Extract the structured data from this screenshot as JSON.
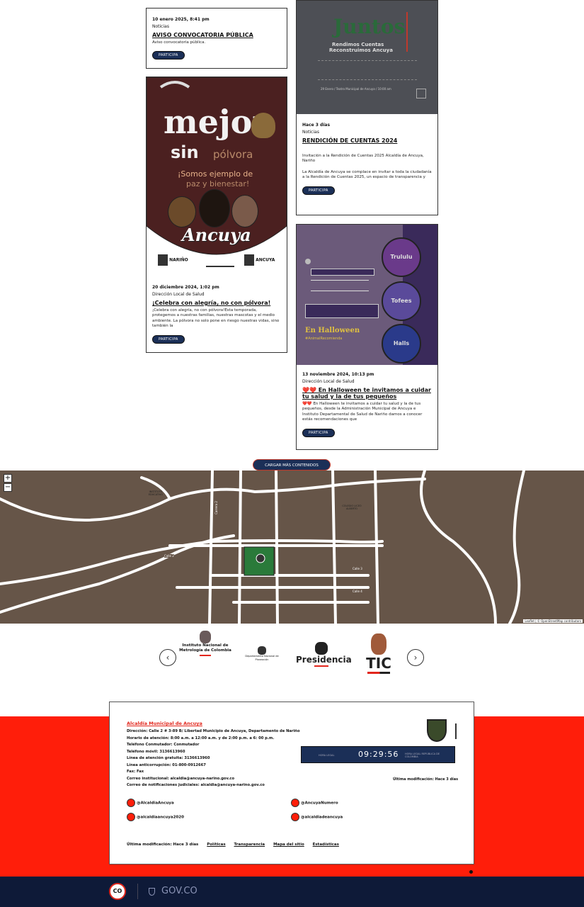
{
  "news": [
    {
      "date": "10 enero 2025, 8:41 pm",
      "category": "Noticias",
      "title": "AVISO CONVOCATORIA PÚBLICA",
      "desc": "Aviso convocatoria pública.",
      "button": "PARTICIPA"
    },
    {
      "image": {
        "line1": "Juntos",
        "line2": "Rendimos Cuentas",
        "line3": "Reconstruimos Ancuya",
        "footer": "29 Enero / Teatro Municipal de Ancuya / 10:00 am"
      },
      "date": "Hace 3 días",
      "category": "Noticias",
      "title": "RENDICIÓN DE CUENTAS 2024",
      "desc1": "Invitación a la Rendición de Cuentas 2025 Alcaldía de Ancuya, Nariño",
      "desc2": "La Alcaldía de Ancuya se complace en invitar a toda la ciudadanía a la Rendición de Cuentas 2025, un espacio de transparencia y",
      "button": "PARTICIPA"
    },
    {
      "image": {
        "word1": "mejor",
        "word2": "sin",
        "word3": "pólvora",
        "slogan1": "¡Somos ejemplo de",
        "slogan2": "paz y bienestar!",
        "brand": "Ancuya",
        "logo1": "NARIÑO",
        "logo2": "ANCUYA"
      },
      "date": "20 diciembre 2024, 1:02 pm",
      "category": "Dirección Local de Salud",
      "title": "¡Celebra con alegría, no con pólvora!",
      "desc": "¡Celebra con alegría, no con pólvora!Esta temporada, protegemos a nuestras familias, nuestras mascotas y el medio ambiente. La pólvora no solo pone en riesgo nuestras vidas, sino también la",
      "button": "PARTICIPA"
    },
    {
      "image": {
        "heading": "En Halloween",
        "hashtag": "#AnimalRecomienda",
        "candy1": "Trululu",
        "candy2": "Tofees",
        "candy3": "Halls"
      },
      "date": "13 noviembre 2024, 10:13 pm",
      "category": "Dirección Local de Salud",
      "title": "❤️❤️ En Halloween te invitamos a cuidar tu salud y la de tus pequeños",
      "desc": "❤️❤️ En Halloween te invitamos a cuidar tu salud y la de tus pequeños, desde la Administración Municipal de Ancuya e Instituto Departamental de Salud de Nariño damos a conocer estás recomendaciones que",
      "button": "PARTICIPA"
    }
  ],
  "load_more": "CARGAR MÁS CONTENIDOS",
  "map": {
    "zoom_in": "+",
    "zoom_out": "−",
    "attribution": "Leaflet | © OpenStreetMap contributors",
    "streets": [
      "Calle 2",
      "Carrera 2",
      "Calle 3",
      "Calle 4"
    ],
    "places": [
      "INSTITUTO EDUCATIVO",
      "COLEGIO LICEO ALBERTO"
    ]
  },
  "partners": [
    {
      "name": "Instituto Nacional de Metrología de Colombia"
    },
    {
      "name": "Departamento Nacional de Planeación"
    },
    {
      "name": "Presidencia"
    },
    {
      "name": "TIC"
    }
  ],
  "footer": {
    "title": "Alcaldía Municipal de Ancuya",
    "lines": [
      "Dirección: Calle 2 # 3-89 B/ Libertad Municipio de Ancuya, Departamento de Nariño",
      "Horario de atención: 8:00 a.m. a 12:00 a.m. y de 2:00 p.m. a 6: 00 p.m.",
      "Teléfono Conmutador: Conmutador",
      "Teléfono móvil: 3136613960",
      "Línea de atención gratuita: 3136613960",
      "Línea anticorrupción: 01-800-0912667",
      "Fax: Fax",
      "Correo institucional: alcaldia@ancuya-narino.gov.co",
      "Correo de notificaciones judiciales: alcaldia@ancuya-narino.gov.co"
    ],
    "clock_time": "09:29:56",
    "clock_left": "HORA LEGAL",
    "clock_right": "HORA LEGAL REPÚBLICA DE COLOMBIA",
    "last_modified_right": "Última modificación: Hace 3 días",
    "socials": [
      "@AlcaldiaAncuya",
      "@AncuyaNumero",
      "@alcaldiaancuya2020",
      "@alcaldiadeancuya"
    ],
    "last_modified": "Última modificación: Hace 3 días",
    "links": [
      "Políticas",
      "Transparencia",
      "Mapa del sitio",
      "Estadísticas"
    ]
  },
  "gov": {
    "co_badge": "CO",
    "gov_text": "GOV.CO"
  }
}
